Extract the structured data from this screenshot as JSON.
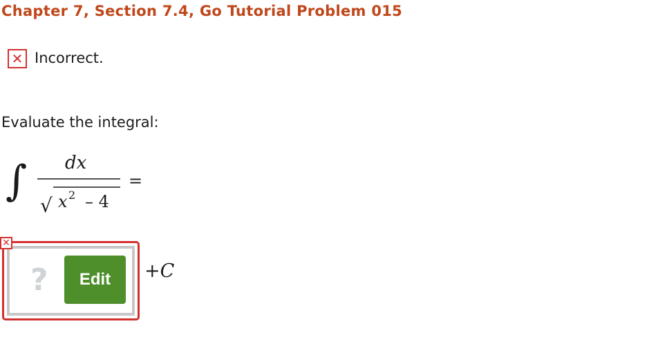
{
  "header": {
    "title": "Chapter 7, Section 7.4, Go Tutorial Problem 015"
  },
  "status": {
    "icon": "close-icon",
    "text": "Incorrect.",
    "color": "#d32f2f"
  },
  "question": {
    "prompt": "Evaluate the integral:",
    "integral_sign": "∫",
    "numerator": "dx",
    "radical_sign": "√",
    "denominator_base": "x",
    "denominator_exponent": "2",
    "denominator_rest": "– 4",
    "equals": "="
  },
  "answer": {
    "error_icon": "close-icon",
    "placeholder_icon": "?",
    "edit_label": "Edit",
    "constant_plus": "+",
    "constant_letter": "C"
  },
  "colors": {
    "title": "#c0471b",
    "error": "#d32f2f",
    "edit_button": "#4e8f2c",
    "placeholder": "#cfd3d6"
  }
}
